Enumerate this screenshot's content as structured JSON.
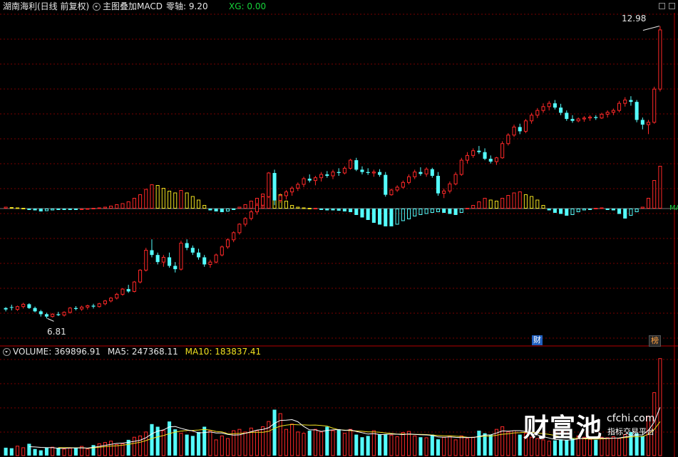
{
  "header": {
    "stock_name": "湖南海利(日线 前复权)",
    "indicator": "主图叠加MACD",
    "zero_axis": "零轴: 9.20",
    "xg": "XG: 0.00"
  },
  "volume_header": {
    "volume": "VOLUME: 369896.91",
    "ma5": "MA5: 247368.11",
    "ma10": "MA10: 183837.41"
  },
  "annotations": {
    "high_price": "12.98",
    "low_price": "6.81",
    "macd_label": "MA",
    "badge_finance": "财",
    "badge_rank": "榜"
  },
  "watermark": {
    "logo": "财富池",
    "site": "cfchi.com",
    "slogan": "指标交易平台"
  },
  "colors": {
    "up": "#ff2828",
    "down": "#54fcfc",
    "macd_pos_weak": "#f0e020",
    "grid": "#7a0000",
    "axis": "#b40000",
    "ma5": "#ffffff",
    "ma10": "#f0e020",
    "badge_bg": "#2060c0"
  },
  "chart_data": {
    "type": "candlestick",
    "price_range": [
      6.5,
      13.2
    ],
    "zero_axis_value": 9.2,
    "candles": [
      [
        7.03,
        7.05,
        6.96,
        7.0
      ],
      [
        7.05,
        7.1,
        6.98,
        7.04
      ],
      [
        7.0,
        7.08,
        6.97,
        7.06
      ],
      [
        7.06,
        7.14,
        7.02,
        7.11
      ],
      [
        7.11,
        7.13,
        7.01,
        7.03
      ],
      [
        7.03,
        7.06,
        6.94,
        6.96
      ],
      [
        6.96,
        6.99,
        6.85,
        6.9
      ],
      [
        6.9,
        6.93,
        6.81,
        6.85
      ],
      [
        6.85,
        6.92,
        6.83,
        6.9
      ],
      [
        6.9,
        6.95,
        6.86,
        6.88
      ],
      [
        6.88,
        6.96,
        6.85,
        6.94
      ],
      [
        6.94,
        7.05,
        6.91,
        7.03
      ],
      [
        7.03,
        7.07,
        6.98,
        7.01
      ],
      [
        7.01,
        7.08,
        6.97,
        7.05
      ],
      [
        7.05,
        7.1,
        7.0,
        7.08
      ],
      [
        7.08,
        7.12,
        7.02,
        7.06
      ],
      [
        7.06,
        7.14,
        7.04,
        7.12
      ],
      [
        7.12,
        7.2,
        7.09,
        7.18
      ],
      [
        7.18,
        7.26,
        7.15,
        7.24
      ],
      [
        7.24,
        7.35,
        7.21,
        7.32
      ],
      [
        7.32,
        7.45,
        7.29,
        7.43
      ],
      [
        7.43,
        7.52,
        7.35,
        7.38
      ],
      [
        7.38,
        7.6,
        7.36,
        7.58
      ],
      [
        7.58,
        7.85,
        7.55,
        7.83
      ],
      [
        7.83,
        8.3,
        7.8,
        8.25
      ],
      [
        8.25,
        8.48,
        8.1,
        8.15
      ],
      [
        8.15,
        8.2,
        7.95,
        8.0
      ],
      [
        8.0,
        8.15,
        7.9,
        8.1
      ],
      [
        8.1,
        8.2,
        7.88,
        7.92
      ],
      [
        7.92,
        8.0,
        7.78,
        7.85
      ],
      [
        7.85,
        8.45,
        7.82,
        8.4
      ],
      [
        8.4,
        8.48,
        8.25,
        8.3
      ],
      [
        8.3,
        8.35,
        8.15,
        8.2
      ],
      [
        8.2,
        8.28,
        8.05,
        8.1
      ],
      [
        8.1,
        8.15,
        7.9,
        7.95
      ],
      [
        7.95,
        8.05,
        7.88,
        8.0
      ],
      [
        8.0,
        8.18,
        7.97,
        8.15
      ],
      [
        8.15,
        8.35,
        8.12,
        8.32
      ],
      [
        8.32,
        8.5,
        8.28,
        8.47
      ],
      [
        8.47,
        8.65,
        8.42,
        8.62
      ],
      [
        8.62,
        8.82,
        8.58,
        8.8
      ],
      [
        8.8,
        8.95,
        8.75,
        8.92
      ],
      [
        8.92,
        9.1,
        8.88,
        9.06
      ],
      [
        9.06,
        9.25,
        9.0,
        9.2
      ],
      [
        9.2,
        9.4,
        9.15,
        9.38
      ],
      [
        9.38,
        9.9,
        9.35,
        9.88
      ],
      [
        9.88,
        9.95,
        9.2,
        9.3
      ],
      [
        9.3,
        9.45,
        9.25,
        9.4
      ],
      [
        9.4,
        9.52,
        9.32,
        9.48
      ],
      [
        9.48,
        9.6,
        9.4,
        9.56
      ],
      [
        9.56,
        9.68,
        9.5,
        9.64
      ],
      [
        9.64,
        9.8,
        9.58,
        9.76
      ],
      [
        9.76,
        9.85,
        9.68,
        9.72
      ],
      [
        9.72,
        9.82,
        9.62,
        9.78
      ],
      [
        9.78,
        9.9,
        9.7,
        9.85
      ],
      [
        9.85,
        9.92,
        9.78,
        9.82
      ],
      [
        9.82,
        9.95,
        9.75,
        9.9
      ],
      [
        9.9,
        9.98,
        9.82,
        9.88
      ],
      [
        9.88,
        10.02,
        9.85,
        9.98
      ],
      [
        9.98,
        10.18,
        9.95,
        10.15
      ],
      [
        10.15,
        10.2,
        9.92,
        9.95
      ],
      [
        9.95,
        10.02,
        9.85,
        9.9
      ],
      [
        9.9,
        9.98,
        9.84,
        9.88
      ],
      [
        9.88,
        9.95,
        9.8,
        9.9
      ],
      [
        9.9,
        9.96,
        9.8,
        9.84
      ],
      [
        9.84,
        9.9,
        9.38,
        9.42
      ],
      [
        9.42,
        9.55,
        9.4,
        9.52
      ],
      [
        9.52,
        9.62,
        9.48,
        9.58
      ],
      [
        9.58,
        9.72,
        9.55,
        9.68
      ],
      [
        9.68,
        9.85,
        9.64,
        9.8
      ],
      [
        9.8,
        9.95,
        9.75,
        9.9
      ],
      [
        9.9,
        10.0,
        9.82,
        9.86
      ],
      [
        9.86,
        10.0,
        9.8,
        9.96
      ],
      [
        9.96,
        9.99,
        9.78,
        9.82
      ],
      [
        9.82,
        9.9,
        9.4,
        9.45
      ],
      [
        9.45,
        9.55,
        9.35,
        9.5
      ],
      [
        9.5,
        9.7,
        9.45,
        9.65
      ],
      [
        9.65,
        9.9,
        9.62,
        9.85
      ],
      [
        9.85,
        10.2,
        9.82,
        10.15
      ],
      [
        10.15,
        10.32,
        10.08,
        10.25
      ],
      [
        10.25,
        10.4,
        10.2,
        10.35
      ],
      [
        10.35,
        10.45,
        10.28,
        10.32
      ],
      [
        10.32,
        10.4,
        10.15,
        10.18
      ],
      [
        10.18,
        10.25,
        10.08,
        10.12
      ],
      [
        10.12,
        10.22,
        10.05,
        10.2
      ],
      [
        10.2,
        10.55,
        10.18,
        10.5
      ],
      [
        10.5,
        10.72,
        10.46,
        10.68
      ],
      [
        10.68,
        10.9,
        10.64,
        10.85
      ],
      [
        10.85,
        10.92,
        10.7,
        10.76
      ],
      [
        10.76,
        11.02,
        10.72,
        10.98
      ],
      [
        10.98,
        11.15,
        10.92,
        11.1
      ],
      [
        11.1,
        11.25,
        11.04,
        11.2
      ],
      [
        11.2,
        11.35,
        11.15,
        11.28
      ],
      [
        11.28,
        11.4,
        11.2,
        11.35
      ],
      [
        11.35,
        11.42,
        11.22,
        11.26
      ],
      [
        11.26,
        11.34,
        11.1,
        11.15
      ],
      [
        11.15,
        11.2,
        10.98,
        11.02
      ],
      [
        11.02,
        11.1,
        10.94,
        10.98
      ],
      [
        10.98,
        11.05,
        10.95,
        11.02
      ],
      [
        11.02,
        11.08,
        10.96,
        11.04
      ],
      [
        11.04,
        11.1,
        10.98,
        11.06
      ],
      [
        11.06,
        11.1,
        11.0,
        11.04
      ],
      [
        11.04,
        11.15,
        11.02,
        11.12
      ],
      [
        11.12,
        11.2,
        11.05,
        11.16
      ],
      [
        11.16,
        11.24,
        11.1,
        11.2
      ],
      [
        11.2,
        11.4,
        11.16,
        11.35
      ],
      [
        11.35,
        11.48,
        11.28,
        11.42
      ],
      [
        11.42,
        11.5,
        11.3,
        11.38
      ],
      [
        11.38,
        11.42,
        10.95,
        11.0
      ],
      [
        11.0,
        11.05,
        10.8,
        10.9
      ],
      [
        10.9,
        11.0,
        10.7,
        10.95
      ],
      [
        10.95,
        11.7,
        10.92,
        11.65
      ],
      [
        11.65,
        12.98,
        11.6,
        12.9
      ]
    ],
    "macd": [
      0.05,
      0.04,
      0.03,
      0.02,
      -0.02,
      -0.05,
      -0.08,
      -0.07,
      -0.05,
      -0.03,
      -0.03,
      -0.02,
      -0.01,
      0.0,
      0.01,
      0.02,
      0.03,
      0.05,
      0.08,
      0.12,
      0.15,
      0.2,
      0.3,
      0.4,
      0.55,
      0.68,
      0.66,
      0.58,
      0.5,
      0.45,
      0.52,
      0.45,
      0.35,
      0.25,
      0.1,
      -0.05,
      -0.08,
      -0.1,
      -0.08,
      -0.03,
      0.05,
      0.12,
      0.22,
      0.3,
      0.42,
      0.58,
      0.55,
      0.4,
      0.22,
      0.1,
      0.05,
      0.03,
      0.02,
      0.02,
      -0.02,
      -0.05,
      -0.05,
      -0.06,
      -0.08,
      -0.1,
      -0.18,
      -0.25,
      -0.32,
      -0.4,
      -0.45,
      -0.5,
      -0.5,
      -0.45,
      -0.35,
      -0.3,
      -0.22,
      -0.18,
      -0.15,
      -0.12,
      -0.1,
      -0.12,
      -0.15,
      -0.18,
      -0.12,
      0.02,
      0.1,
      0.2,
      0.3,
      0.25,
      0.22,
      0.3,
      0.38,
      0.45,
      0.48,
      0.4,
      0.35,
      0.25,
      0.1,
      -0.05,
      -0.12,
      -0.15,
      -0.2,
      -0.18,
      -0.1,
      -0.05,
      -0.02,
      0.02,
      0.03,
      -0.02,
      -0.05,
      -0.15,
      -0.28,
      -0.2,
      -0.1,
      0.05,
      0.3,
      0.8,
      1.2
    ],
    "volume_range": [
      0,
      380000
    ],
    "volume": [
      30000,
      28000,
      36000,
      30000,
      45000,
      25000,
      20000,
      30000,
      32000,
      30000,
      25000,
      28000,
      30000,
      35000,
      25000,
      40000,
      45000,
      50000,
      55000,
      42000,
      45000,
      60000,
      70000,
      75000,
      90000,
      120000,
      110000,
      95000,
      130000,
      100000,
      85000,
      80000,
      75000,
      90000,
      110000,
      95000,
      60000,
      75000,
      65000,
      95000,
      100000,
      90000,
      105000,
      95000,
      110000,
      130000,
      175000,
      160000,
      100000,
      120000,
      90000,
      85000,
      95000,
      100000,
      90000,
      110000,
      95000,
      100000,
      85000,
      100000,
      80000,
      70000,
      75000,
      95000,
      80000,
      82000,
      78000,
      72000,
      88000,
      92000,
      75000,
      70000,
      68000,
      80000,
      62000,
      70000,
      75000,
      60000,
      75000,
      65000,
      70000,
      95000,
      85000,
      80000,
      100000,
      110000,
      90000,
      95000,
      80000,
      85000,
      70000,
      65000,
      60000,
      55000,
      58000,
      62000,
      60000,
      65000,
      75000,
      70000,
      62000,
      60000,
      70000,
      68000,
      72000,
      65000,
      80000,
      90000,
      85000,
      75000,
      150000,
      240000,
      369896.91
    ]
  }
}
